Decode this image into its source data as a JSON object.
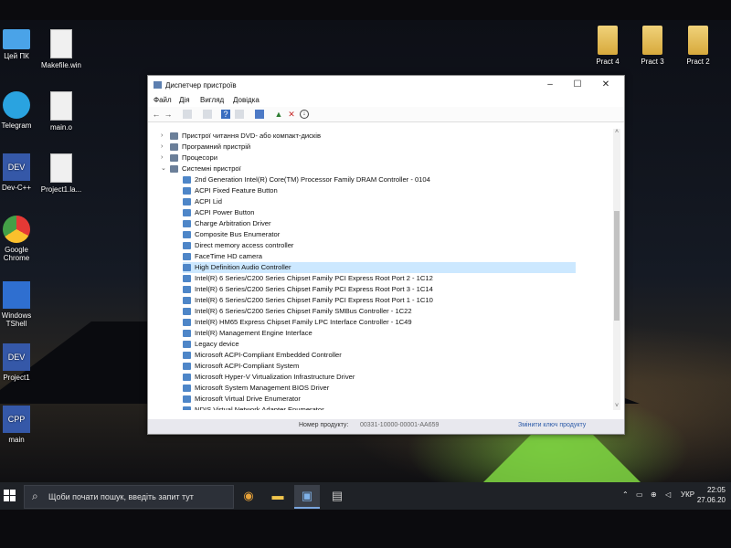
{
  "desktop": {
    "icons_left": [
      {
        "name": "this-pc-icon",
        "label": "Цей ПК"
      },
      {
        "name": "makefile-win-icon",
        "label": "Makefile.win"
      },
      {
        "name": "telegram-icon",
        "label": "Telegram"
      },
      {
        "name": "main-o-icon",
        "label": "main.o"
      },
      {
        "name": "devcpp-icon",
        "label": "Dev-C++"
      },
      {
        "name": "project1-layout-icon",
        "label": "Project1.la..."
      },
      {
        "name": "chrome-icon",
        "label": "Google Chrome"
      },
      {
        "name": "windows-tshell-icon",
        "label": "Windows TShell"
      },
      {
        "name": "project1-icon",
        "label": "Project1"
      },
      {
        "name": "main-icon",
        "label": "main"
      }
    ],
    "icons_right": [
      {
        "label": "Pract 4"
      },
      {
        "label": "Pract 3"
      },
      {
        "label": "Pract 2"
      }
    ]
  },
  "window": {
    "title": "Диспетчер пристроїв",
    "menu": [
      "Файл",
      "Дія",
      "Вигляд",
      "Довідка"
    ],
    "tree": [
      {
        "level": 0,
        "expander": "›",
        "label": "Пристрої читання DVD- або компакт-дисків"
      },
      {
        "level": 0,
        "expander": "›",
        "label": "Програмний пристрій"
      },
      {
        "level": 0,
        "expander": "›",
        "label": "Процесори"
      },
      {
        "level": 0,
        "expander": "⌄",
        "label": "Системні пристрої"
      },
      {
        "level": 1,
        "label": "2nd Generation Intel(R) Core(TM) Processor Family DRAM Controller - 0104"
      },
      {
        "level": 1,
        "label": "ACPI Fixed Feature Button"
      },
      {
        "level": 1,
        "label": "ACPI Lid"
      },
      {
        "level": 1,
        "label": "ACPI Power Button"
      },
      {
        "level": 1,
        "label": "Charge Arbitration Driver"
      },
      {
        "level": 1,
        "label": "Composite Bus Enumerator"
      },
      {
        "level": 1,
        "label": "Direct memory access controller"
      },
      {
        "level": 1,
        "label": "FaceTime HD camera"
      },
      {
        "level": 1,
        "label": "High Definition Audio Controller",
        "selected": true
      },
      {
        "level": 1,
        "label": "Intel(R) 6 Series/C200 Series Chipset Family PCI Express Root Port 2 - 1C12"
      },
      {
        "level": 1,
        "label": "Intel(R) 6 Series/C200 Series Chipset Family PCI Express Root Port 3 - 1C14"
      },
      {
        "level": 1,
        "label": "Intel(R) 6 Series/C200 Series Chipset Family PCI Express Root Port 1 - 1C10"
      },
      {
        "level": 1,
        "label": "Intel(R) 6 Series/C200 Series Chipset Family SMBus Controller - 1C22"
      },
      {
        "level": 1,
        "label": "Intel(R) HM65 Express Chipset Family LPC Interface Controller - 1C49"
      },
      {
        "level": 1,
        "label": "Intel(R) Management Engine Interface"
      },
      {
        "level": 1,
        "label": "Legacy device"
      },
      {
        "level": 1,
        "label": "Microsoft ACPI-Compliant Embedded Controller"
      },
      {
        "level": 1,
        "label": "Microsoft ACPI-Compliant System"
      },
      {
        "level": 1,
        "label": "Microsoft Hyper-V Virtualization Infrastructure Driver"
      },
      {
        "level": 1,
        "label": "Microsoft System Management BIOS Driver"
      },
      {
        "level": 1,
        "label": "Microsoft Virtual Drive Enumerator"
      },
      {
        "level": 1,
        "label": "NDIS Virtual Network Adapter Enumerator"
      }
    ]
  },
  "behind_status": {
    "product_id_label": "Номер продукту:",
    "product_id_value": "00331-10000-00001-AA659",
    "change_key_link": "Змінити ключ продукту"
  },
  "taskbar": {
    "search_placeholder": "Щоби почати пошук, введіть запит тут",
    "language": "УКР",
    "time": "22:05",
    "date": "27.06.20"
  },
  "colors": {
    "taskbar_bg": "#1f2227",
    "selection": "#cce8ff",
    "device_icon": "#4e86c8"
  }
}
